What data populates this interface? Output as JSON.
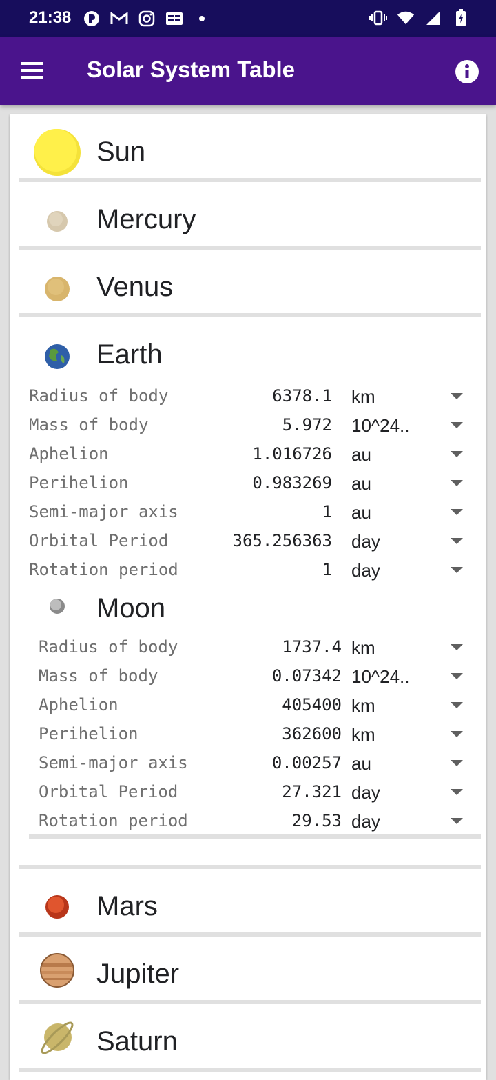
{
  "status_bar": {
    "time": "21:38",
    "left_icons": [
      "app-icon",
      "gmail-icon",
      "instagram-icon",
      "news-icon",
      "dot-icon"
    ],
    "right_icons": [
      "vibrate-icon",
      "wifi-icon",
      "signal-icon",
      "battery-icon"
    ]
  },
  "app_bar": {
    "title": "Solar System Table",
    "menu_icon": "menu-icon",
    "info_icon": "info-icon"
  },
  "colors": {
    "status_bar": "#170d5c",
    "app_bar": "#4a148c",
    "sun": "#fff04a",
    "mercury": "#d6c8ad",
    "venus": "#d8b56c",
    "mars": "#d84a25",
    "jupiter": "#d9a070",
    "saturn": "#c9b66a"
  },
  "bodies": [
    {
      "name": "Sun"
    },
    {
      "name": "Mercury"
    },
    {
      "name": "Venus"
    },
    {
      "name": "Earth",
      "properties": [
        {
          "label": "Radius of body",
          "value": "6378.1",
          "unit": "km"
        },
        {
          "label": "Mass of body",
          "value": "5.972",
          "unit": "10^24.."
        },
        {
          "label": "Aphelion",
          "value": "1.016726",
          "unit": "au"
        },
        {
          "label": "Perihelion",
          "value": "0.983269",
          "unit": "au"
        },
        {
          "label": "Semi-major axis",
          "value": "1",
          "unit": "au"
        },
        {
          "label": "Orbital Period",
          "value": "365.256363",
          "unit": "day"
        },
        {
          "label": "Rotation period",
          "value": "1",
          "unit": "day"
        }
      ],
      "satellites": [
        {
          "name": "Moon",
          "properties": [
            {
              "label": "Radius of body",
              "value": "1737.4",
              "unit": "km"
            },
            {
              "label": "Mass of body",
              "value": "0.07342",
              "unit": "10^24.."
            },
            {
              "label": "Aphelion",
              "value": "405400",
              "unit": "km"
            },
            {
              "label": "Perihelion",
              "value": "362600",
              "unit": "km"
            },
            {
              "label": "Semi-major axis",
              "value": "0.00257",
              "unit": "au"
            },
            {
              "label": "Orbital Period",
              "value": "27.321",
              "unit": "day"
            },
            {
              "label": "Rotation period",
              "value": "29.53",
              "unit": "day"
            }
          ]
        }
      ]
    },
    {
      "name": "Mars"
    },
    {
      "name": "Jupiter"
    },
    {
      "name": "Saturn"
    }
  ]
}
